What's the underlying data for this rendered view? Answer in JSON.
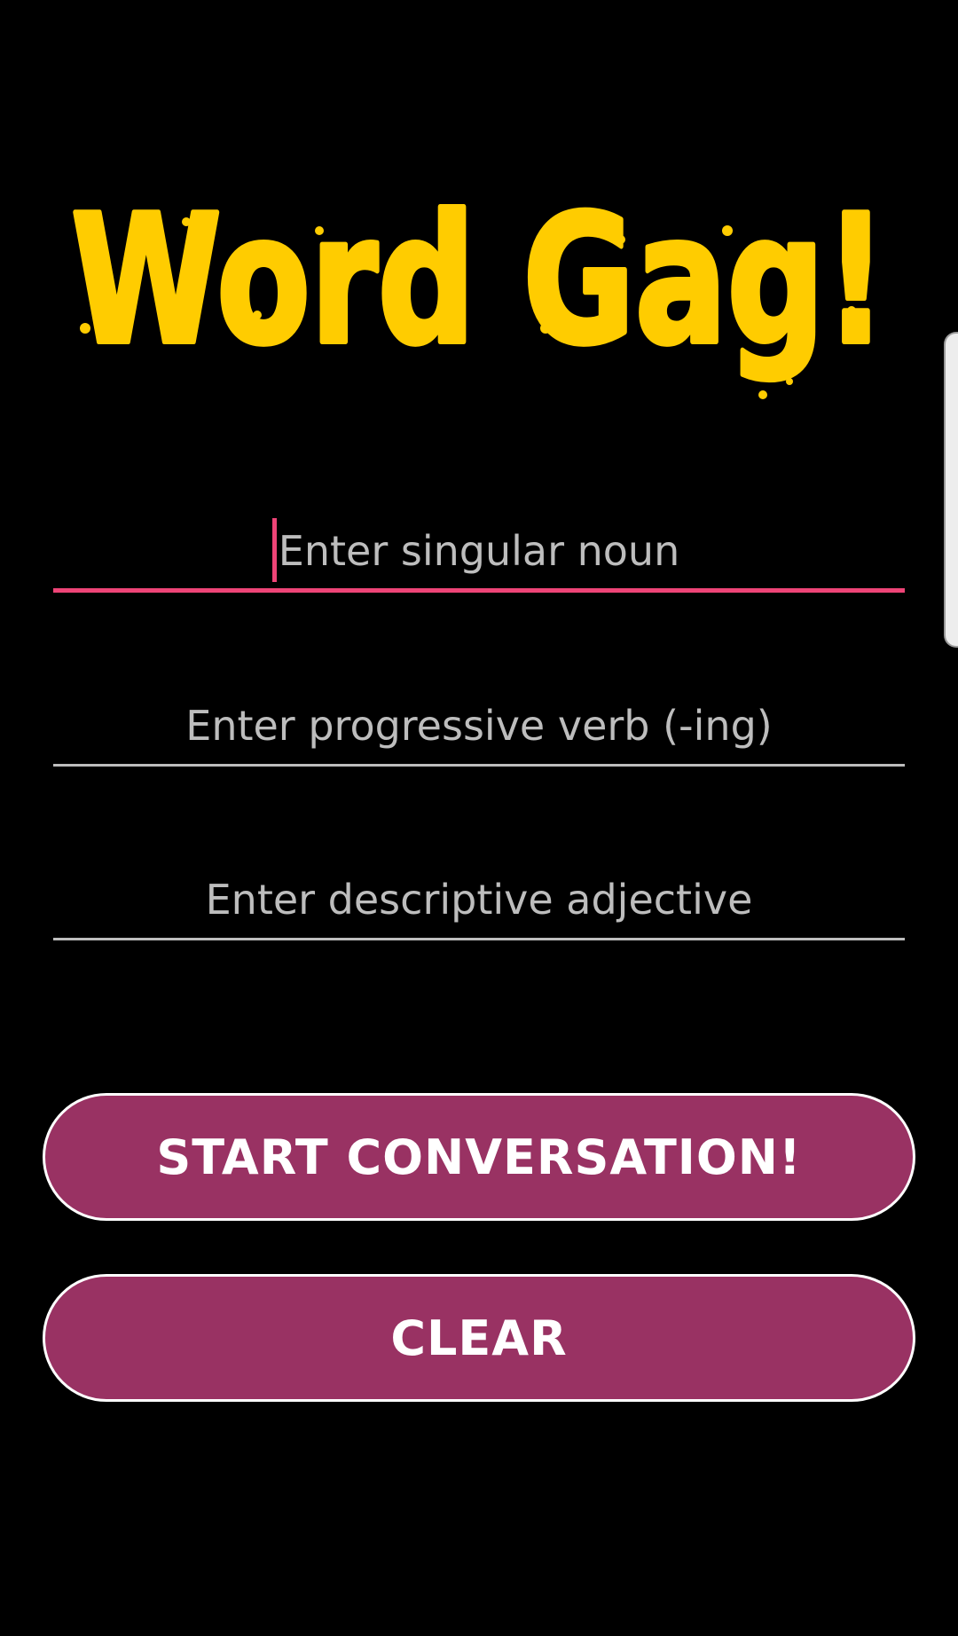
{
  "app": {
    "title": "Word Gag!"
  },
  "form": {
    "noun_placeholder": "Enter singular noun",
    "verb_placeholder": "Enter progressive verb (-ing)",
    "adjective_placeholder": "Enter descriptive adjective"
  },
  "buttons": {
    "start_label": "START CONVERSATION!",
    "clear_label": "CLEAR"
  },
  "colors": {
    "background": "#000000",
    "title": "#FFCC00",
    "accent": "#EE4477",
    "button": "#993263",
    "placeholder": "#BDBDBD"
  }
}
